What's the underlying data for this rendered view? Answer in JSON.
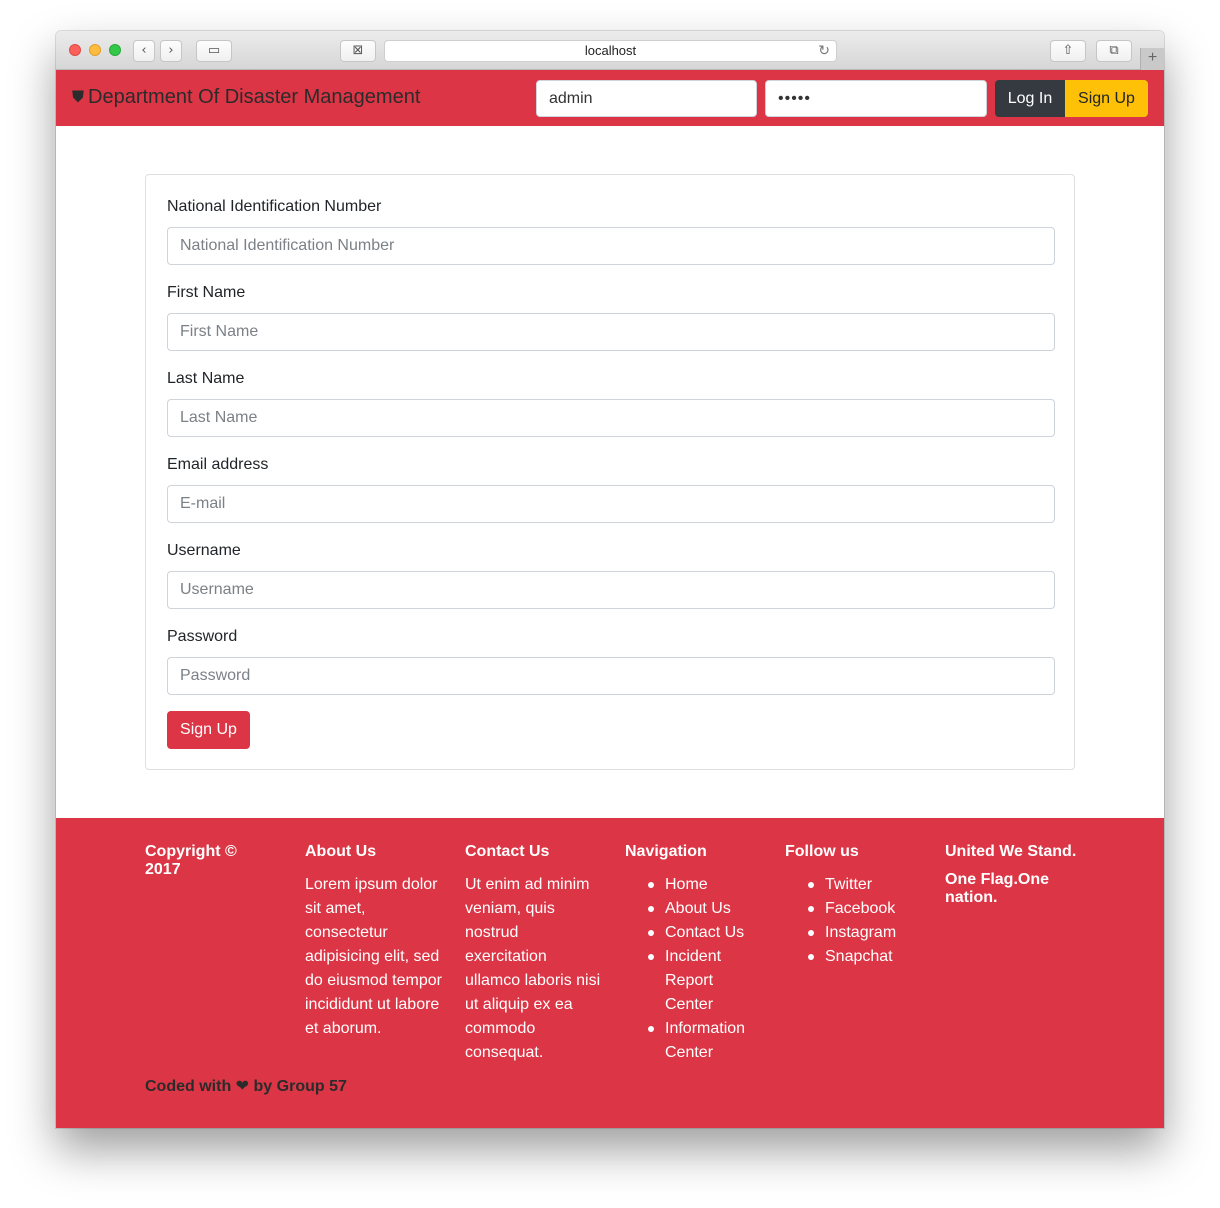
{
  "browser": {
    "url": "localhost"
  },
  "navbar": {
    "brand": "Department Of Disaster Management",
    "username_value": "admin",
    "password_value": "•••••",
    "login_label": "Log In",
    "signup_label": "Sign Up"
  },
  "form": {
    "nin": {
      "label": "National Identification Number",
      "placeholder": "National Identification Number"
    },
    "first_name": {
      "label": "First Name",
      "placeholder": "First Name"
    },
    "last_name": {
      "label": "Last Name",
      "placeholder": "Last Name"
    },
    "email": {
      "label": "Email address",
      "placeholder": "E-mail"
    },
    "username": {
      "label": "Username",
      "placeholder": "Username"
    },
    "password": {
      "label": "Password",
      "placeholder": "Password"
    },
    "submit_label": "Sign Up"
  },
  "footer": {
    "copyright": "Copyright © 2017",
    "about": {
      "heading": "About Us",
      "text": "Lorem ipsum dolor sit amet, consectetur adipisicing elit, sed do eiusmod tempor incididunt ut labore et aborum."
    },
    "contact": {
      "heading": "Contact Us",
      "text": "Ut enim ad minim veniam, quis nostrud exercitation ullamco laboris nisi ut aliquip ex ea commodo consequat."
    },
    "navigation": {
      "heading": "Navigation",
      "items": [
        "Home",
        "About Us",
        "Contact Us",
        "Incident Report Center",
        "Information Center"
      ]
    },
    "follow": {
      "heading": "Follow us",
      "items": [
        "Twitter",
        "Facebook",
        "Instagram",
        "Snapchat"
      ]
    },
    "motto_line1": "United We Stand.",
    "motto_line2": "One Flag.One nation.",
    "credit_prefix": "Coded with",
    "credit_suffix": "by Group 57"
  },
  "icons": {
    "brand": "shield-icon",
    "heart": "heart-icon"
  },
  "colors": {
    "navbar": "#dc3545",
    "footer": "#dc3545",
    "login_button": "#343a40",
    "signup_button": "#ffc107",
    "submit_button": "#dc3545"
  }
}
